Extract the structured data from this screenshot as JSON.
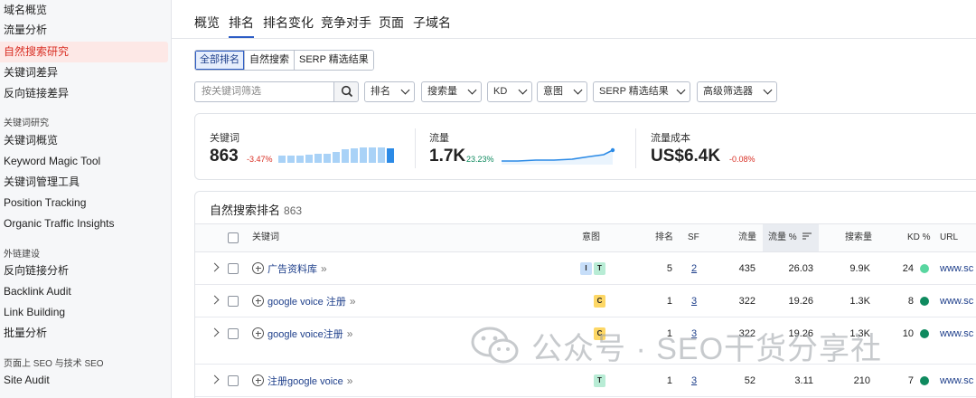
{
  "sidebar": {
    "items": [
      {
        "label": "域名概览",
        "active": false
      },
      {
        "label": "流量分析",
        "active": false
      },
      {
        "label": "自然搜索研究",
        "active": true
      },
      {
        "label": "关键词差异",
        "active": false
      },
      {
        "label": "反向链接差异",
        "active": false
      }
    ],
    "section_keyword": "关键词研究",
    "keyword_items": [
      "关键词概览",
      "Keyword Magic Tool",
      "关键词管理工具",
      "Position Tracking",
      "Organic Traffic Insights"
    ],
    "section_links": "外链建设",
    "link_items": [
      "反向链接分析",
      "Backlink Audit",
      "Link Building",
      "批量分析"
    ],
    "section_tech": "页面上 SEO 与技术 SEO",
    "tech_items": [
      "Site Audit"
    ]
  },
  "tabs": [
    "概览",
    "排名",
    "排名变化",
    "竞争对手",
    "页面",
    "子域名"
  ],
  "active_tab": "排名",
  "segments": [
    "全部排名",
    "自然搜索",
    "SERP 精选结果"
  ],
  "active_segment": "全部排名",
  "filters": {
    "search_placeholder": "按关键词筛选",
    "dropdowns": [
      "排名",
      "搜索量",
      "KD",
      "意图",
      "SERP 精选结果",
      "高级筛选器"
    ]
  },
  "metrics": {
    "keywords": {
      "label": "关键词",
      "value": "863",
      "delta": "-3.47%"
    },
    "traffic": {
      "label": "流量",
      "value": "1.7K",
      "delta": "23.23%"
    },
    "cost": {
      "label": "流量成本",
      "value": "US$6.4K",
      "delta": "-0.08%"
    }
  },
  "table": {
    "title": "自然搜索排名",
    "count": "863",
    "columns": {
      "keyword": "关键词",
      "intent": "意图",
      "position": "排名",
      "sf": "SF",
      "traffic": "流量",
      "traffic_pct": "流量 %",
      "volume": "搜索量",
      "kd": "KD %",
      "url": "URL"
    },
    "rows": [
      {
        "keyword": "广告资料库",
        "intents": [
          "I",
          "T"
        ],
        "position": "5",
        "sf": "2",
        "traffic": "435",
        "traffic_pct": "26.03",
        "volume": "9.9K",
        "kd": "24",
        "kd_color": "#59d6a0",
        "url": "www.sc"
      },
      {
        "keyword": "google voice 注册",
        "intents": [
          "C"
        ],
        "position": "1",
        "sf": "3",
        "traffic": "322",
        "traffic_pct": "19.26",
        "volume": "1.3K",
        "kd": "8",
        "kd_color": "#0f8a5f",
        "url": "www.sc"
      },
      {
        "keyword": "google voice注册",
        "intents": [
          "C"
        ],
        "position": "1",
        "sf": "3",
        "traffic": "322",
        "traffic_pct": "19.26",
        "volume": "1.3K",
        "kd": "10",
        "kd_color": "#0f8a5f",
        "url": "www.sc"
      },
      {
        "keyword": "注册google voice",
        "intents": [
          "T"
        ],
        "position": "1",
        "sf": "3",
        "traffic": "52",
        "traffic_pct": "3.11",
        "volume": "210",
        "kd": "7",
        "kd_color": "#0f8a5f",
        "url": "www.sc"
      }
    ]
  },
  "watermark": {
    "text": "公众号 · SEO干货分享社"
  }
}
